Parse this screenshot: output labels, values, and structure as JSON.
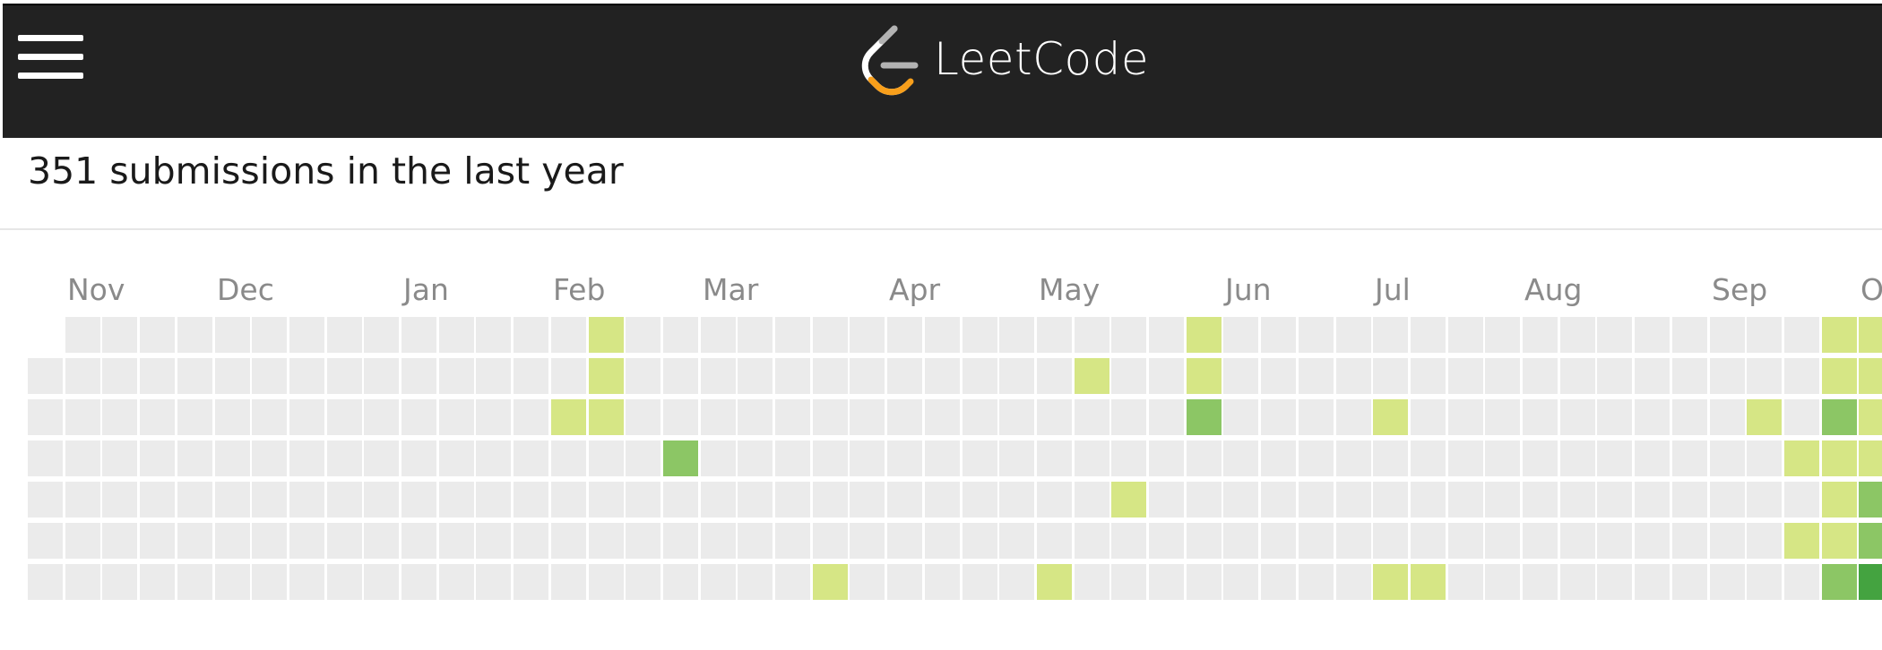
{
  "header": {
    "menu_icon": "hamburger-menu-icon",
    "logo_icon": "leetcode-logo-icon",
    "brand_name": "LeetCode",
    "background": "#222222"
  },
  "summary": {
    "title": "351 submissions in the last year"
  },
  "calendar": {
    "months": [
      {
        "label": "Nov",
        "week": 1
      },
      {
        "label": "Dec",
        "week": 5
      },
      {
        "label": "Jan",
        "week": 10
      },
      {
        "label": "Feb",
        "week": 14
      },
      {
        "label": "Mar",
        "week": 18
      },
      {
        "label": "Apr",
        "week": 23
      },
      {
        "label": "May",
        "week": 27
      },
      {
        "label": "Jun",
        "week": 32
      },
      {
        "label": "Jul",
        "week": 36
      },
      {
        "label": "Aug",
        "week": 40
      },
      {
        "label": "Sep",
        "week": 45
      },
      {
        "label": "O",
        "week": 49
      }
    ],
    "weeks": 51,
    "days_per_week": 7,
    "first_week_start_day": 1,
    "colors": [
      "#ebebeb",
      "#d6e685",
      "#8cc665",
      "#44a340"
    ],
    "active_days": [
      {
        "week": 15,
        "day": 0,
        "level": 1
      },
      {
        "week": 15,
        "day": 1,
        "level": 1
      },
      {
        "week": 15,
        "day": 2,
        "level": 1
      },
      {
        "week": 14,
        "day": 2,
        "level": 1
      },
      {
        "week": 17,
        "day": 3,
        "level": 2
      },
      {
        "week": 21,
        "day": 6,
        "level": 1
      },
      {
        "week": 27,
        "day": 6,
        "level": 1
      },
      {
        "week": 28,
        "day": 1,
        "level": 1
      },
      {
        "week": 29,
        "day": 4,
        "level": 1
      },
      {
        "week": 31,
        "day": 0,
        "level": 1
      },
      {
        "week": 31,
        "day": 1,
        "level": 1
      },
      {
        "week": 31,
        "day": 2,
        "level": 2
      },
      {
        "week": 36,
        "day": 2,
        "level": 1
      },
      {
        "week": 36,
        "day": 6,
        "level": 1
      },
      {
        "week": 37,
        "day": 6,
        "level": 1
      },
      {
        "week": 46,
        "day": 2,
        "level": 1
      },
      {
        "week": 47,
        "day": 3,
        "level": 1
      },
      {
        "week": 47,
        "day": 5,
        "level": 1
      },
      {
        "week": 48,
        "day": 0,
        "level": 1
      },
      {
        "week": 48,
        "day": 1,
        "level": 1
      },
      {
        "week": 48,
        "day": 2,
        "level": 2
      },
      {
        "week": 48,
        "day": 3,
        "level": 1
      },
      {
        "week": 48,
        "day": 4,
        "level": 1
      },
      {
        "week": 48,
        "day": 5,
        "level": 1
      },
      {
        "week": 48,
        "day": 6,
        "level": 2
      },
      {
        "week": 49,
        "day": 0,
        "level": 1
      },
      {
        "week": 49,
        "day": 1,
        "level": 1
      },
      {
        "week": 49,
        "day": 2,
        "level": 1
      },
      {
        "week": 49,
        "day": 3,
        "level": 1
      },
      {
        "week": 49,
        "day": 4,
        "level": 2
      },
      {
        "week": 49,
        "day": 5,
        "level": 2
      },
      {
        "week": 49,
        "day": 6,
        "level": 3
      }
    ]
  }
}
